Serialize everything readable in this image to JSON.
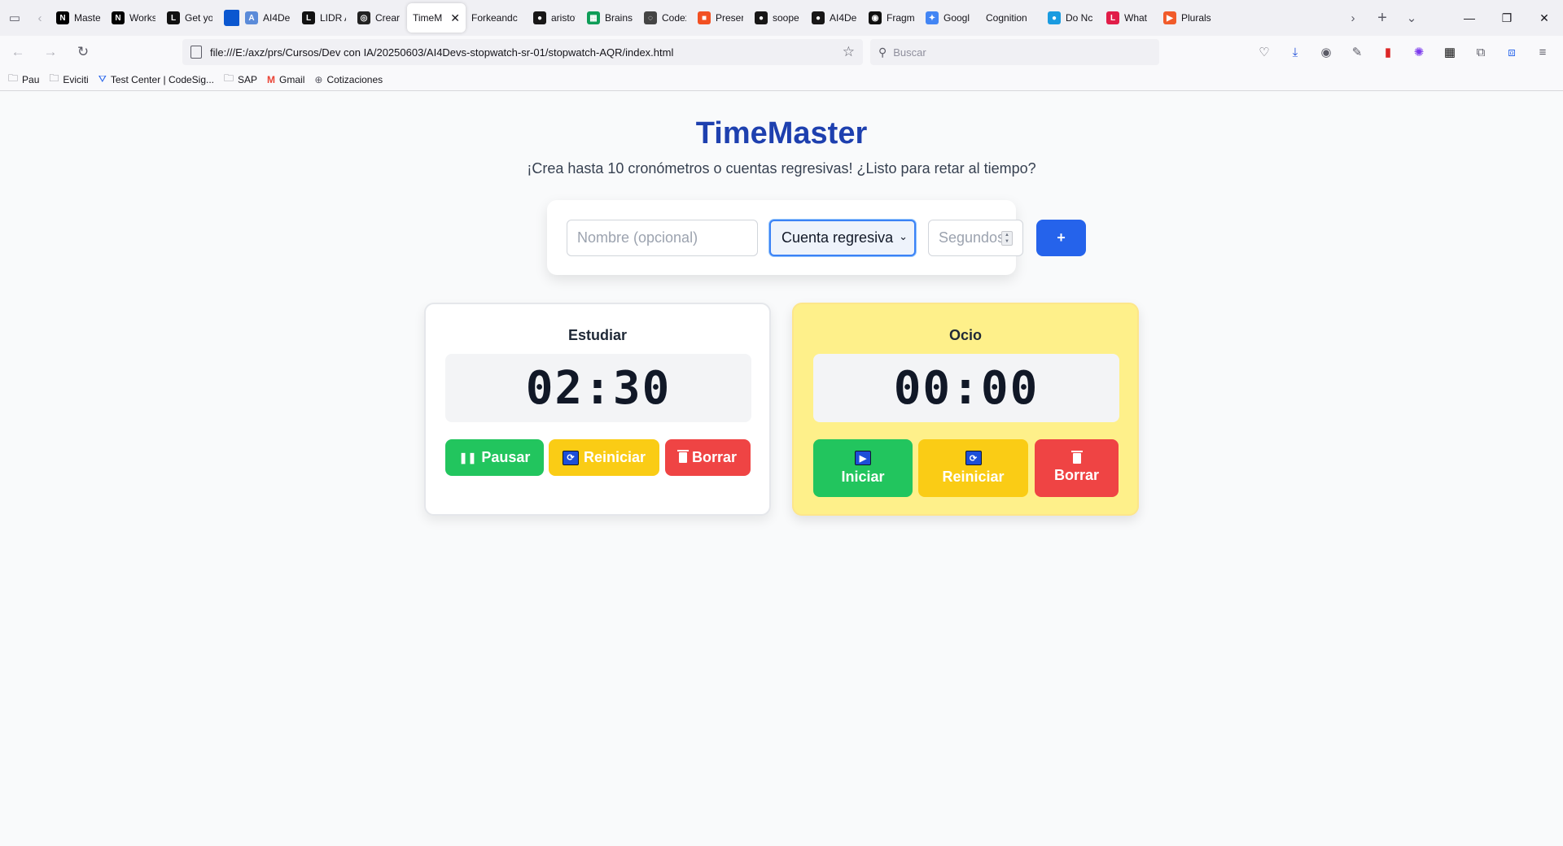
{
  "browser": {
    "tabs": [
      {
        "label": "Maste",
        "icon": "notion-icon",
        "color": "#000000",
        "glyph": "N"
      },
      {
        "label": "Works",
        "icon": "notion-icon",
        "color": "#000000",
        "glyph": "N"
      },
      {
        "label": "Get yo",
        "icon": "lidr-icon",
        "color": "#111111",
        "glyph": "L"
      },
      {
        "label": "",
        "icon": "blue-square-icon",
        "color": "#0b57d0",
        "glyph": ""
      },
      {
        "label": "AI4De",
        "icon": "ai4devs-icon",
        "color": "#5b8bd9",
        "glyph": "A"
      },
      {
        "label": "LIDR A",
        "icon": "lidr-icon",
        "color": "#111111",
        "glyph": "L"
      },
      {
        "label": "Crear",
        "icon": "openai-icon",
        "color": "#222222",
        "glyph": "◎"
      },
      {
        "label": "TimeMa",
        "icon": "",
        "color": "",
        "glyph": ""
      },
      {
        "label": "Forkeandc",
        "icon": "",
        "color": "",
        "glyph": ""
      },
      {
        "label": "aristot",
        "icon": "github-icon",
        "color": "#181717",
        "glyph": "●"
      },
      {
        "label": "Brains",
        "icon": "sheets-icon",
        "color": "#0f9d58",
        "glyph": "▦"
      },
      {
        "label": "Codex",
        "icon": "codex-icon",
        "color": "#444444",
        "glyph": "◌"
      },
      {
        "label": "Preser",
        "icon": "microsoft-icon",
        "color": "#f25022",
        "glyph": "■"
      },
      {
        "label": "soope",
        "icon": "github-icon",
        "color": "#181717",
        "glyph": "●"
      },
      {
        "label": "AI4De",
        "icon": "github-icon",
        "color": "#181717",
        "glyph": "●"
      },
      {
        "label": "Fragm",
        "icon": "fragment-icon",
        "color": "#111111",
        "glyph": "◉"
      },
      {
        "label": "Googl",
        "icon": "gemini-icon",
        "color": "#4285f4",
        "glyph": "✦"
      },
      {
        "label": "Cognition",
        "icon": "",
        "color": "",
        "glyph": ""
      },
      {
        "label": "Do Nc",
        "icon": "globe-icon",
        "color": "#1a9be0",
        "glyph": "●"
      },
      {
        "label": "What",
        "icon": "l-icon",
        "color": "#e11d48",
        "glyph": "L"
      },
      {
        "label": "Plurals",
        "icon": "pluralsight-icon",
        "color": "#f15b2a",
        "glyph": "▶"
      }
    ],
    "url": "file:///E:/axz/prs/Cursos/Dev con IA/20250603/AI4Devs-stopwatch-sr-01/stopwatch-AQR/index.html",
    "search_placeholder": "Buscar",
    "bookmarks": [
      {
        "label": "Pau",
        "icon": "folder-icon"
      },
      {
        "label": "Eviciti",
        "icon": "folder-icon"
      },
      {
        "label": "Test Center | CodeSig...",
        "icon": "codesignal-icon"
      },
      {
        "label": "SAP",
        "icon": "folder-icon"
      },
      {
        "label": "Gmail",
        "icon": "gmail-icon"
      },
      {
        "label": "Cotizaciones",
        "icon": "globe-icon"
      }
    ]
  },
  "app": {
    "title": "TimeMaster",
    "subtitle": "¡Crea hasta 10 cronómetros o cuentas regresivas! ¿Listo para retar al tiempo?",
    "creator": {
      "name_placeholder": "Nombre (opcional)",
      "type_selected": "Cuenta regresiva",
      "seconds_placeholder": "Segundos",
      "add_label": "+"
    },
    "timers": [
      {
        "name": "Estudiar",
        "time": "02:30",
        "pause_label": "Pausar",
        "reset_label": "Reiniciar",
        "delete_label": "Borrar"
      },
      {
        "name": "Ocio",
        "time": "00:00",
        "start_label": "Iniciar",
        "reset_label": "Reiniciar",
        "delete_label": "Borrar"
      }
    ]
  },
  "colors": {
    "title": "#1e40af",
    "add_button": "#2563eb",
    "green": "#22c55e",
    "amber": "#facc15",
    "red": "#ef4444",
    "finished_card": "#fef08a"
  }
}
